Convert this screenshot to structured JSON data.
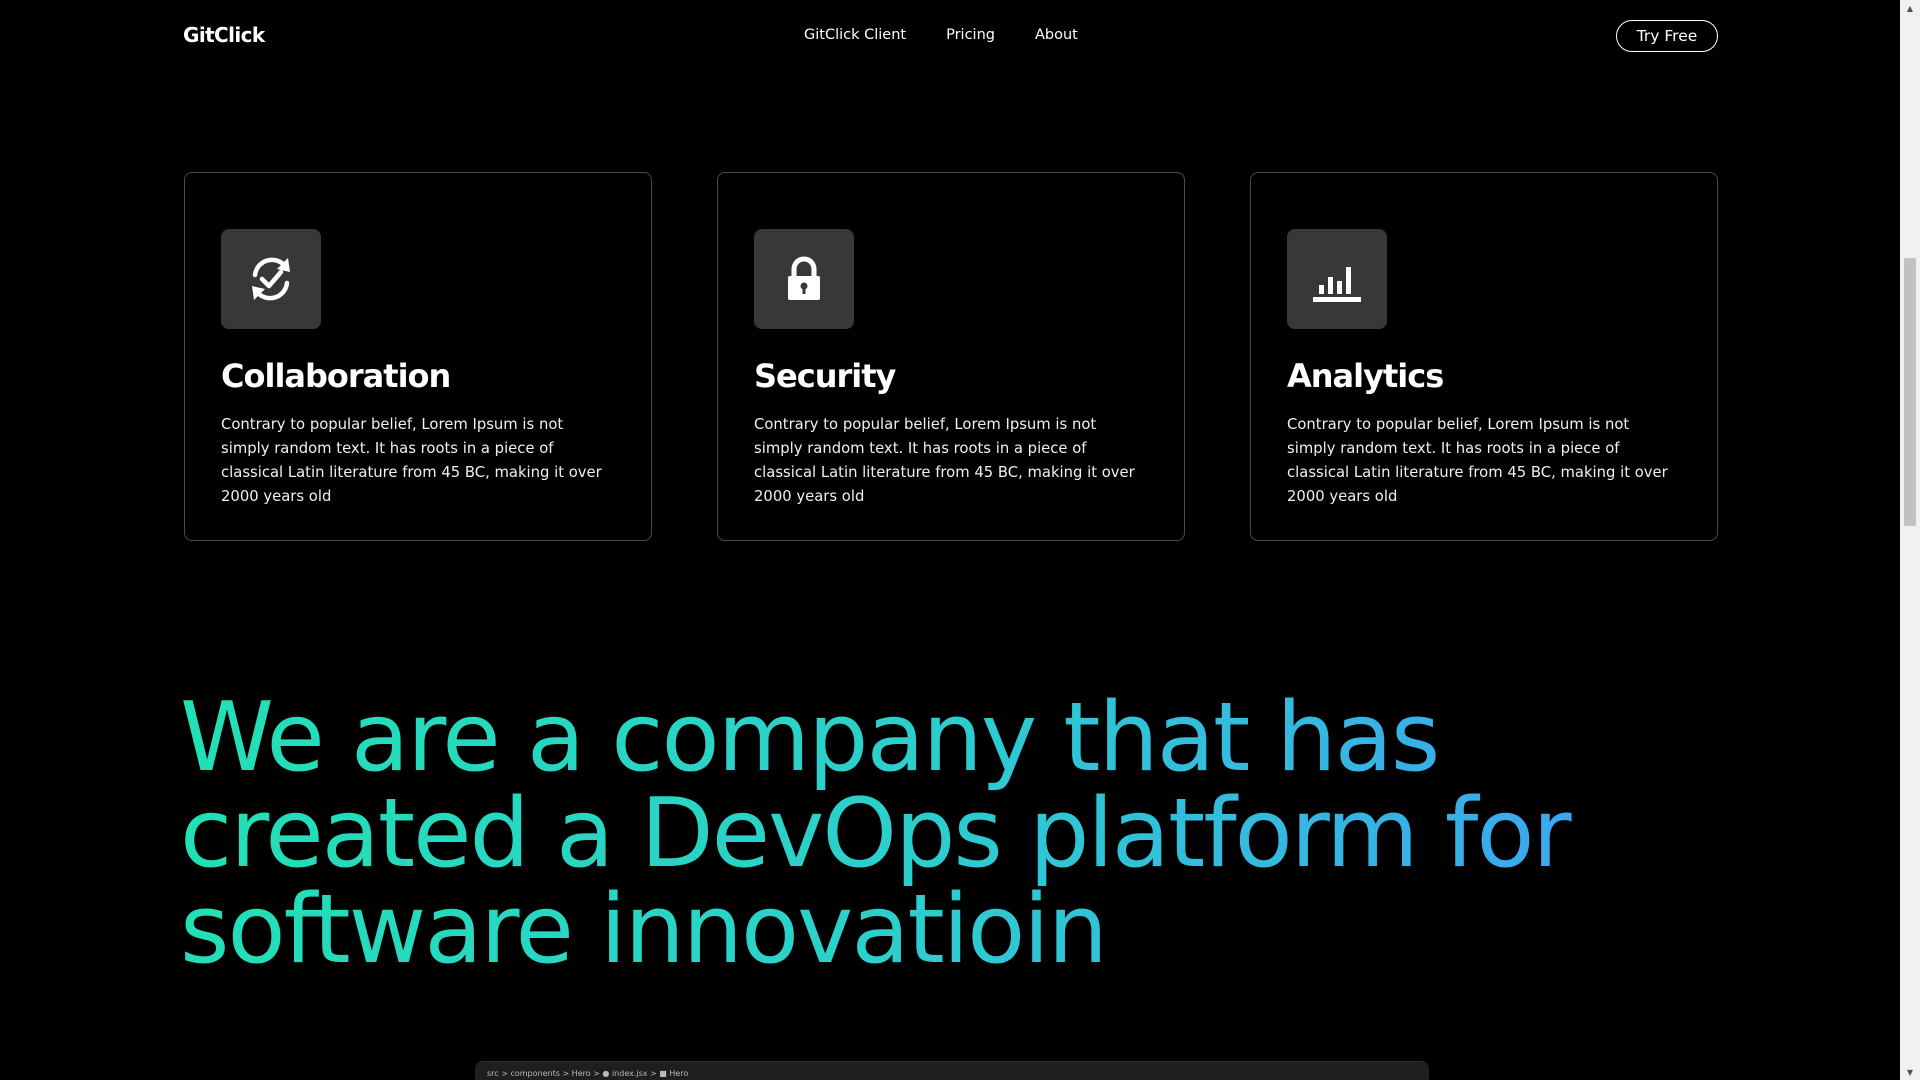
{
  "header": {
    "logo": "GitClick",
    "nav": [
      "GitClick Client",
      "Pricing",
      "About"
    ],
    "cta": "Try Free"
  },
  "features": [
    {
      "icon": "sync-check-icon",
      "title": "Collaboration",
      "text": "Contrary to popular belief, Lorem Ipsum is not simply random text. It has roots in a piece of classical Latin literature from 45 BC, making it over 2000 years old"
    },
    {
      "icon": "lock-icon",
      "title": "Security",
      "text": "Contrary to popular belief, Lorem Ipsum is not simply random text. It has roots in a piece of classical Latin literature from 45 BC, making it over 2000 years old"
    },
    {
      "icon": "bar-chart-icon",
      "title": "Analytics",
      "text": "Contrary to popular belief, Lorem Ipsum is not simply random text. It has roots in a piece of classical Latin literature from 45 BC, making it over 2000 years old"
    }
  ],
  "headline": {
    "lines": [
      "We are a company that has",
      "created a DevOps platform for",
      "software innovatioin"
    ]
  },
  "editor": {
    "breadcrumb": "src > components > Hero > ● index.jsx > ■ Hero"
  },
  "colors": {
    "background": "#000000",
    "card_border": "#4a4a4a",
    "icon_tile": "#383838",
    "gradient_start": "#22e0b5",
    "gradient_end": "#4a8ff5"
  }
}
